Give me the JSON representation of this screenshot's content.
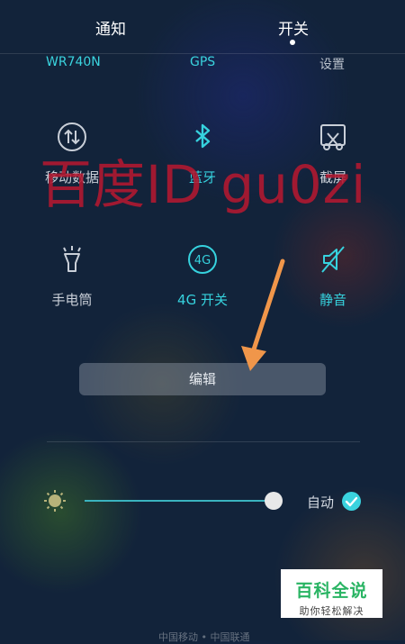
{
  "tabs": {
    "notify": "通知",
    "toggles": "开关"
  },
  "top_row": {
    "wifi": "WR740N",
    "gps": "GPS",
    "settings": "设置"
  },
  "tiles": [
    {
      "label": "移动数据",
      "icon": "mobile-data-icon",
      "active": false
    },
    {
      "label": "蓝牙",
      "icon": "bluetooth-icon",
      "active": true
    },
    {
      "label": "截屏",
      "icon": "screenshot-icon",
      "active": false
    },
    {
      "label": "手电筒",
      "icon": "flashlight-icon",
      "active": false
    },
    {
      "label": "4G 开关",
      "icon": "4g-icon",
      "active": true
    },
    {
      "label": "静音",
      "icon": "mute-icon",
      "active": true
    }
  ],
  "watermark": "百度ID gu0zi",
  "edit_label": "编辑",
  "brightness": {
    "level": 0.97,
    "auto_label": "自动",
    "auto_checked": true
  },
  "badge": {
    "title": "百科全说",
    "subtitle": "助你轻松解决"
  },
  "carrier": "中国移动 • 中国联通",
  "colors": {
    "accent": "#36d2de",
    "inactive": "#c9cfd8",
    "watermark": "#b41830",
    "arrow": "#f0964a"
  }
}
